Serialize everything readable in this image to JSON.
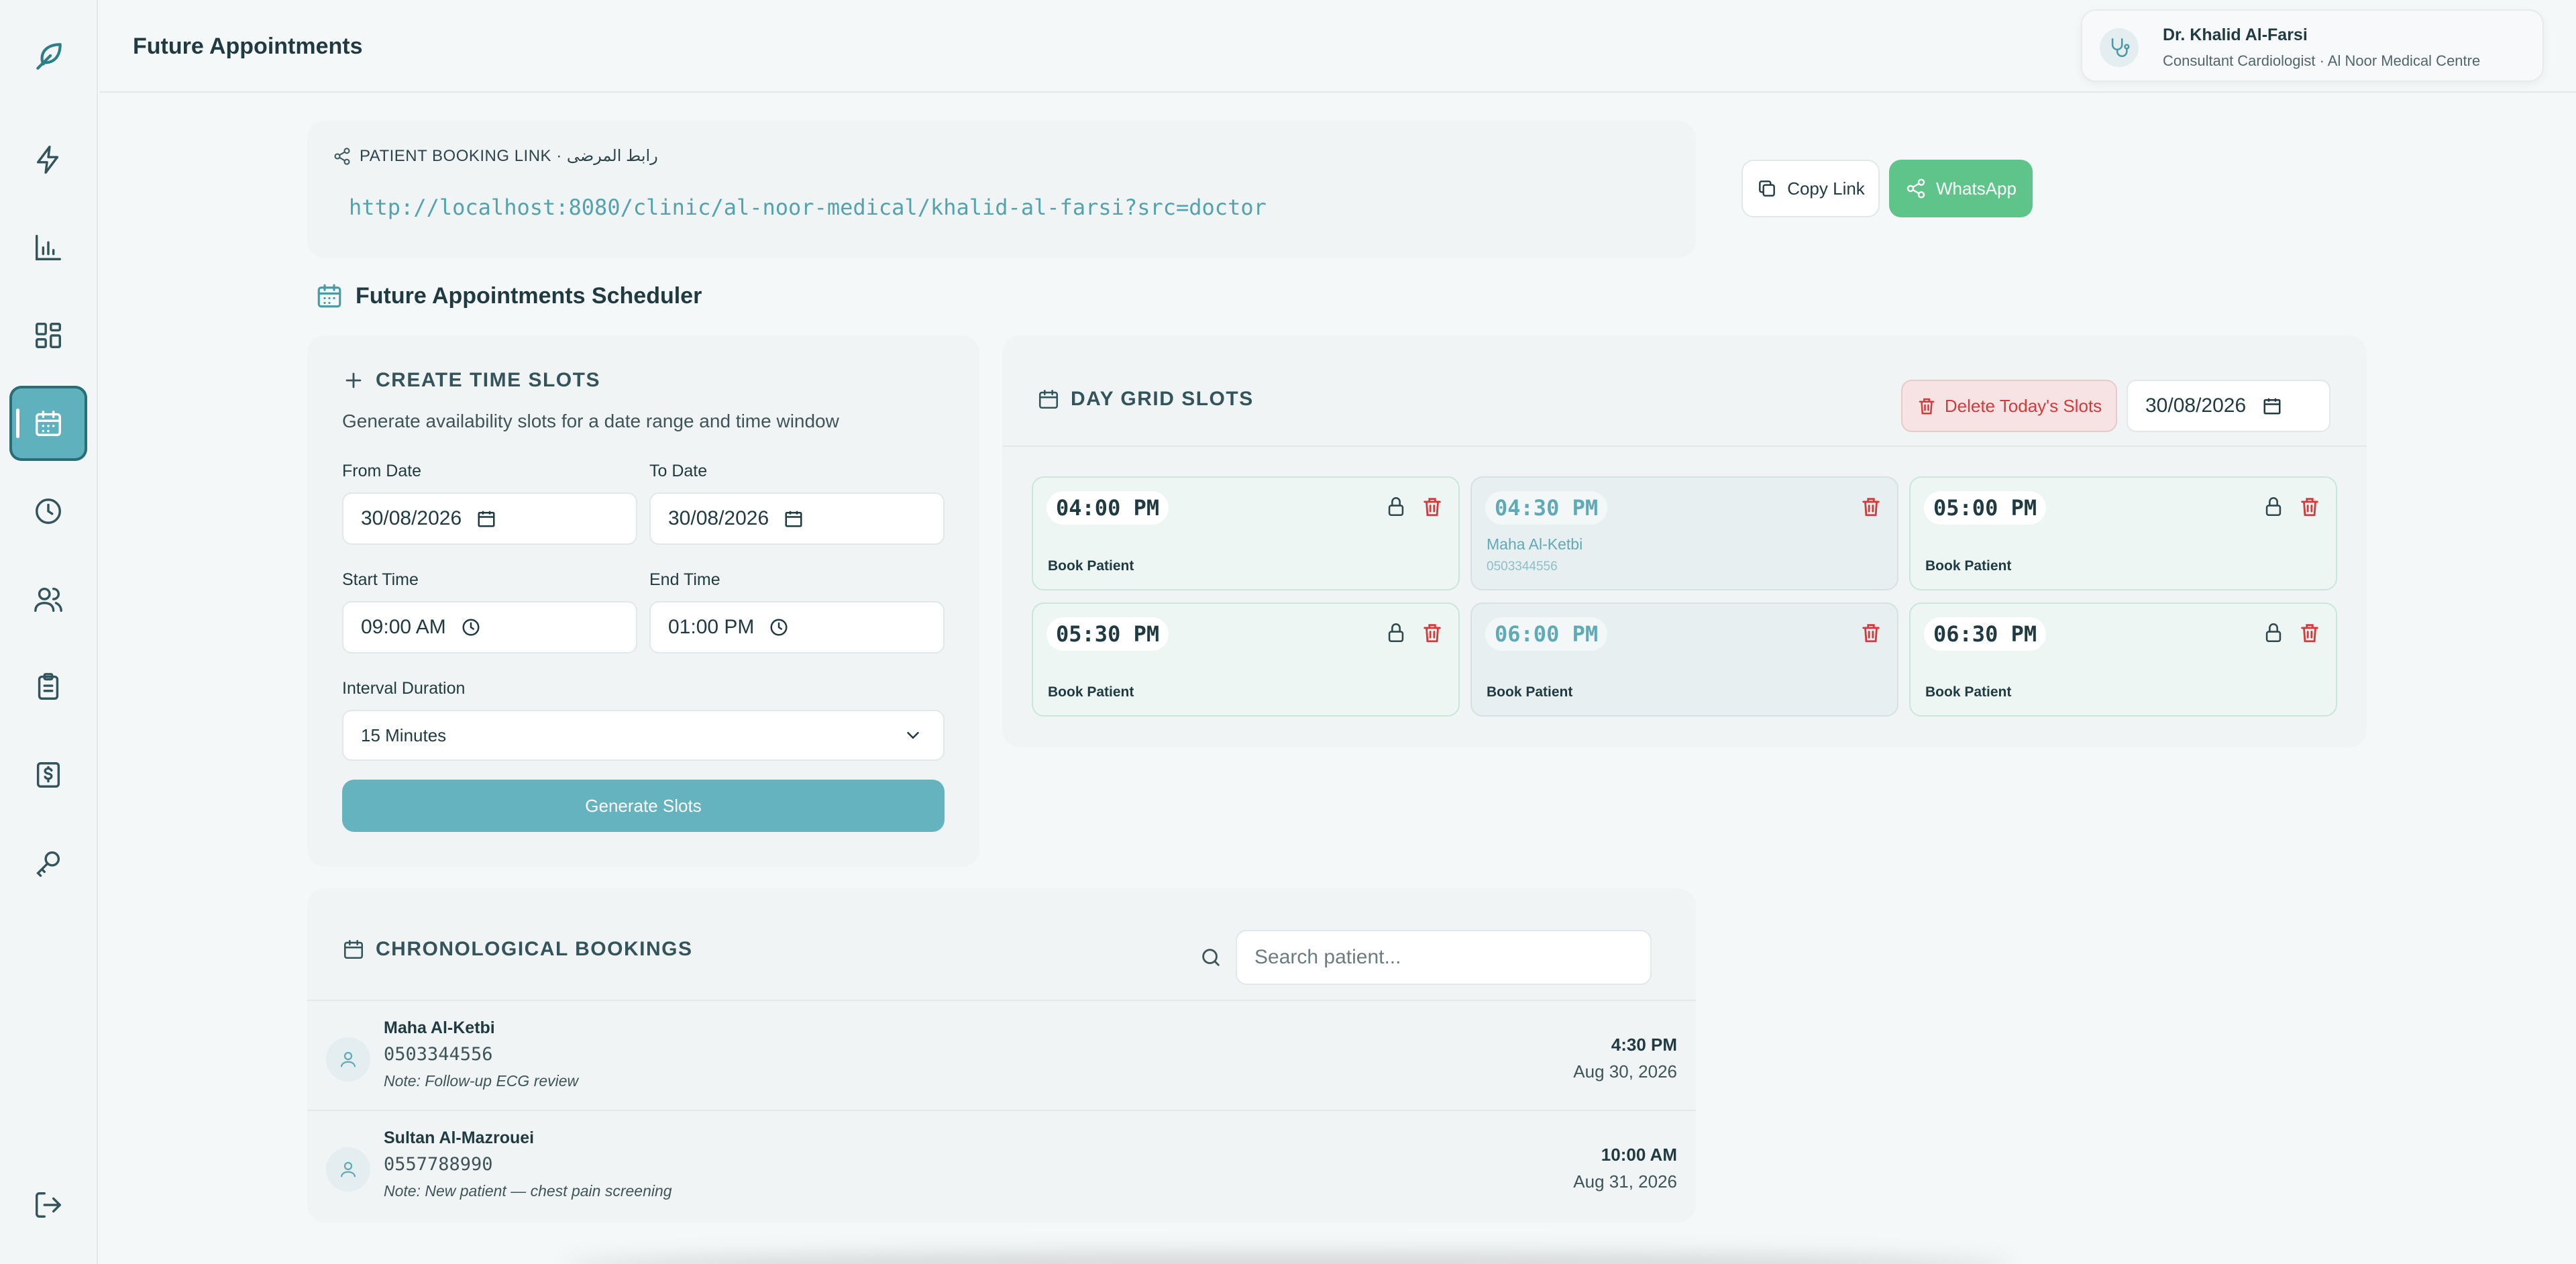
{
  "header": {
    "title": "Future Appointments",
    "doctor_name": "Dr. Khalid Al-Farsi",
    "doctor_role": "Consultant Cardiologist · Al Noor Medical Centre"
  },
  "sidebar": {
    "items": [
      {
        "name": "bolt-icon"
      },
      {
        "name": "bar-chart-icon"
      },
      {
        "name": "grid-icon"
      },
      {
        "name": "calendar-icon",
        "active": true
      },
      {
        "name": "clock-icon"
      },
      {
        "name": "users-icon"
      },
      {
        "name": "clipboard-icon"
      },
      {
        "name": "dollar-icon"
      },
      {
        "name": "key-icon"
      },
      {
        "name": "logout-icon"
      }
    ]
  },
  "booking_link": {
    "label": "PATIENT BOOKING LINK · رابط المرضى",
    "url": "http://localhost:8080/clinic/al-noor-medical/khalid-al-farsi?src=doctor",
    "copy_label": "Copy Link",
    "whatsapp_label": "WhatsApp"
  },
  "scheduler": {
    "title": "Future Appointments Scheduler"
  },
  "create_slots": {
    "title": "CREATE TIME SLOTS",
    "subtitle": "Generate availability slots for a date range and time window",
    "from_label": "From Date",
    "from_value": "30/08/2026",
    "to_label": "To Date",
    "to_value": "30/08/2026",
    "start_label": "Start Time",
    "start_value": "09:00 AM",
    "end_label": "End Time",
    "end_value": "01:00 PM",
    "interval_label": "Interval Duration",
    "interval_value": "15 Minutes",
    "generate_label": "Generate Slots"
  },
  "day_grid": {
    "title": "DAY GRID SLOTS",
    "delete_label": "Delete Today's Slots",
    "date_value": "30/08/2026",
    "slots": [
      {
        "time": "04:00 PM",
        "action": "Book Patient",
        "status": "open"
      },
      {
        "time": "04:30 PM",
        "patient": "Maha Al-Ketbi",
        "phone": "0503344556",
        "status": "booked"
      },
      {
        "time": "05:00 PM",
        "action": "Book Patient",
        "status": "open"
      },
      {
        "time": "05:30 PM",
        "action": "Book Patient",
        "status": "open"
      },
      {
        "time": "06:00 PM",
        "action": "Book Patient",
        "status": "past"
      },
      {
        "time": "06:30 PM",
        "action": "Book Patient",
        "status": "open"
      }
    ]
  },
  "bookings": {
    "title": "CHRONOLOGICAL BOOKINGS",
    "search_placeholder": "Search patient...",
    "rows": [
      {
        "name": "Maha Al-Ketbi",
        "phone": "0503344556",
        "note": "Note: Follow-up ECG review",
        "time": "4:30 PM",
        "date": "Aug 30, 2026"
      },
      {
        "name": "Sultan Al-Mazrouei",
        "phone": "0557788990",
        "note": "Note: New patient — chest pain screening",
        "time": "10:00 AM",
        "date": "Aug 31, 2026"
      }
    ]
  },
  "colors": {
    "accent": "#5fb1bd",
    "whatsapp": "#5fc48a",
    "danger": "#d23b3b",
    "open_slot_bg": "#edf6f3"
  }
}
